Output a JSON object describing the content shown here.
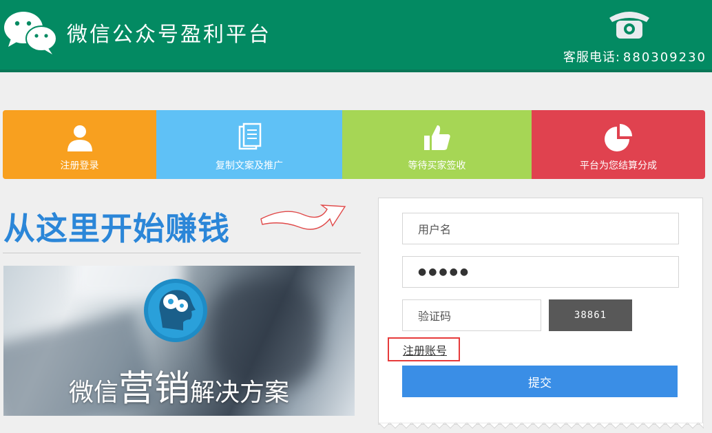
{
  "header": {
    "title": "微信公众号盈利平台",
    "hotline_label": "客服电话:",
    "hotline_number": "880309230",
    "bg_color": "#038a62"
  },
  "steps": [
    {
      "label": "注册登录",
      "icon": "user-icon",
      "color": "#f8a01f"
    },
    {
      "label": "复制文案及推广",
      "icon": "document-icon",
      "color": "#5fc1f6"
    },
    {
      "label": "等待买家签收",
      "icon": "thumbs-up-icon",
      "color": "#a6d655"
    },
    {
      "label": "平台为您结算分成",
      "icon": "pie-chart-icon",
      "color": "#e0424f"
    }
  ],
  "slogan": "从这里开始赚钱",
  "banner": {
    "text_prefix": "微信",
    "text_big": "营销",
    "text_suffix": "解决方案"
  },
  "form": {
    "username_placeholder": "用户名",
    "password_value": "●●●●●",
    "code_placeholder": "验证码",
    "captcha_text": "38861",
    "register_link": "注册账号",
    "submit_label": "提交",
    "submit_color": "#3a8ee6"
  }
}
